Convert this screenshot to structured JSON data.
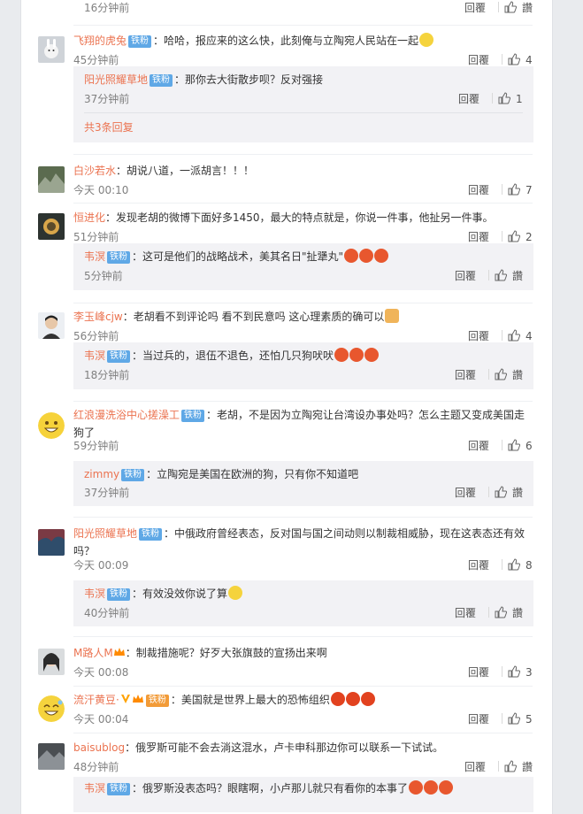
{
  "labels": {
    "reply": "回覆",
    "sub_reply": "回覆",
    "like_zh": "讚"
  },
  "colors": {
    "name": "#eb7350",
    "badge": "#5fa8e6",
    "sub_bg": "#f2f2f5"
  },
  "top_row": {
    "time": "16分钟前",
    "like": "讚"
  },
  "comments": [
    {
      "name": "飞翔的虎兔",
      "badge": "铁粉",
      "text": "：哈哈，报应来的这么快，此刻俺与立陶宛人民站在一起",
      "time": "45分钟前",
      "likes": "4",
      "subs": [
        {
          "name": "阳光照耀草地",
          "badge": "铁粉",
          "text": "：那你去大街散步呗？反对强接",
          "time": "37分钟前",
          "likes": "1"
        }
      ],
      "more": "共3条回复"
    },
    {
      "name": "白沙若水",
      "text": "：胡说八道，一派胡言！！！",
      "time": "今天 00:10",
      "likes": "7"
    },
    {
      "name": "恒进化",
      "text": "：发现老胡的微博下面好多1450，最大的特点就是，你说一件事，他扯另一件事。",
      "time": "51分钟前",
      "likes": "2",
      "subs": [
        {
          "name": "韦溟",
          "badge": "铁粉",
          "text": "：这可是他们的战略战术，美其名日\"扯犟丸\"",
          "time": "5分钟前",
          "likes": "讚"
        }
      ]
    },
    {
      "name": "李玉峰cjw",
      "text": "：老胡看不到评论吗  看不到民意吗  这心理素质的确可以",
      "time": "56分钟前",
      "likes": "4",
      "subs": [
        {
          "name": "韦溟",
          "badge": "铁粉",
          "text": "：当过兵的，退伍不退色，还怕几只狗吠吠",
          "time": "18分钟前",
          "likes": "讚"
        }
      ]
    },
    {
      "name": "红浪漫洗浴中心搓澡工",
      "badge": "铁粉",
      "text": "：老胡，不是因为立陶宛让台湾设办事处吗？怎么主题又变成美国走狗了",
      "time": "59分钟前",
      "likes": "6",
      "subs": [
        {
          "name": "zimmy",
          "badge": "铁粉",
          "text": "：立陶宛是美国在欧洲的狗，只有你不知道吧",
          "time": "37分钟前",
          "likes": "讚"
        }
      ]
    },
    {
      "name": "阳光照耀草地",
      "badge": "铁粉",
      "text": "：中俄政府曾经表态，反对国与国之间动则以制裁相威胁，现在这表态还有效吗？",
      "time": "今天 00:09",
      "likes": "8",
      "subs": [
        {
          "name": "韦溟",
          "badge": "铁粉",
          "text": "：有效没效你说了算",
          "time": "40分钟前",
          "likes": "讚"
        }
      ]
    },
    {
      "name": "M路人M",
      "text": "：制裁措施呢？好歹大张旗鼓的宣扬出来啊",
      "time": "今天 00:08",
      "likes": "3"
    },
    {
      "name": "流汗黄豆·",
      "badge": "铁粉",
      "text": "：美国就是世界上最大的恐怖组织",
      "time": "今天 00:04",
      "likes": "5"
    },
    {
      "name": "baisublog",
      "text": "：俄罗斯可能不会去淌这混水，卢卡申科那边你可以联系一下试试。",
      "time": "48分钟前",
      "likes": "讚",
      "subs": [
        {
          "name": "韦溟",
          "badge": "铁粉",
          "text": "：俄罗斯没表态吗？眼瞎啊，小卢那儿就只有看你的本事了",
          "time": "",
          "likes": ""
        }
      ]
    }
  ]
}
